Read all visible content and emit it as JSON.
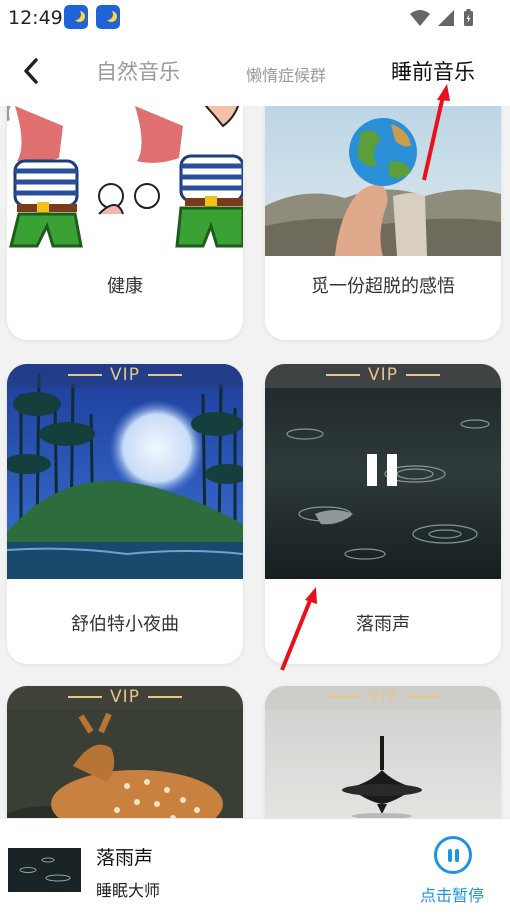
{
  "status_bar": {
    "time": "12:49",
    "icons": [
      "app-notification-icon",
      "app-notification-icon",
      "wifi-icon",
      "signal-icon",
      "battery-charging-icon"
    ]
  },
  "header": {
    "back_icon": "chevron-left-icon",
    "tabs": [
      {
        "label": "自然音乐",
        "active": false
      },
      {
        "label": "懒惰症候群",
        "active": false
      },
      {
        "label": "睡前音乐",
        "active": true
      }
    ]
  },
  "cards": [
    {
      "title": "健康",
      "vip": false
    },
    {
      "title": "觅一份超脱的感悟",
      "vip": false
    },
    {
      "title": "舒伯特小夜曲",
      "vip": true,
      "vip_label": "VIP"
    },
    {
      "title": "落雨声",
      "vip": true,
      "vip_label": "VIP",
      "playing": true
    },
    {
      "title": "",
      "vip": true,
      "vip_label": "VIP"
    },
    {
      "title": "",
      "vip": true,
      "vip_label": "VIP"
    }
  ],
  "player": {
    "title": "落雨声",
    "artist": "睡眠大师",
    "action_label": "点击暂停",
    "action_icon": "pause-circle-icon"
  },
  "colors": {
    "accent": "#1a94e8",
    "vip_gold": "#e7c58a",
    "annotation_arrow": "#e8101b"
  }
}
